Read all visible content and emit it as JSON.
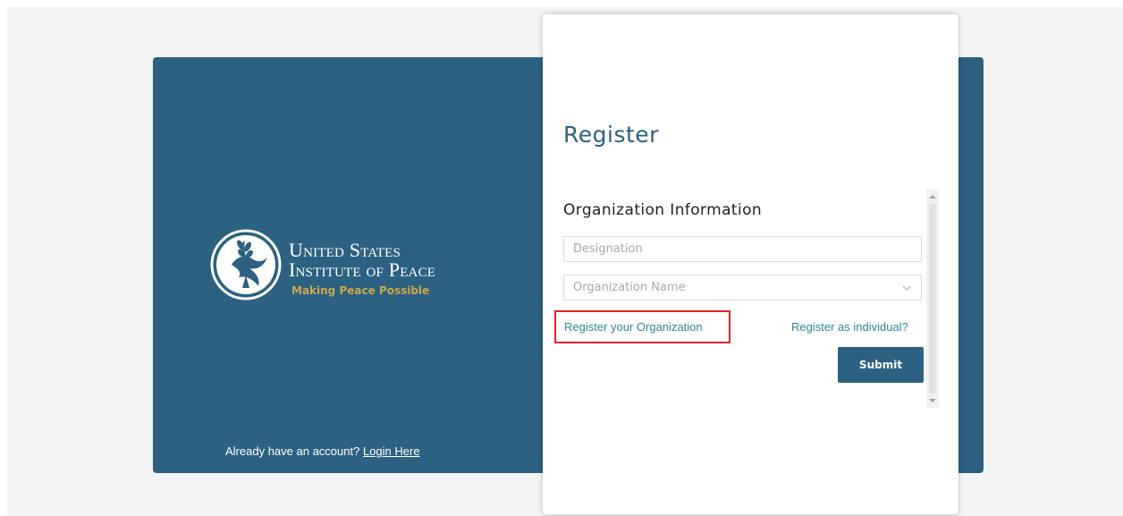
{
  "brand": {
    "logo_line1": "United States",
    "logo_line2": "Institute of Peace",
    "tagline": "Making Peace Possible",
    "emblem_icon": "olive-branch-dove-icon",
    "panel_color": "#2c6181",
    "tagline_color": "#c9a84c"
  },
  "login_prompt": {
    "text": "Already have an account?",
    "link_label": "Login Here"
  },
  "form": {
    "title": "Register",
    "section_title": "Organization Information",
    "designation_placeholder": "Designation",
    "designation_value": "",
    "org_name_placeholder": "Organization Name",
    "register_org_label": "Register your Organization",
    "register_individual_label": "Register as individual?",
    "submit_label": "Submit",
    "link_color": "#2a8a9a",
    "highlight_color": "#e0242a"
  }
}
